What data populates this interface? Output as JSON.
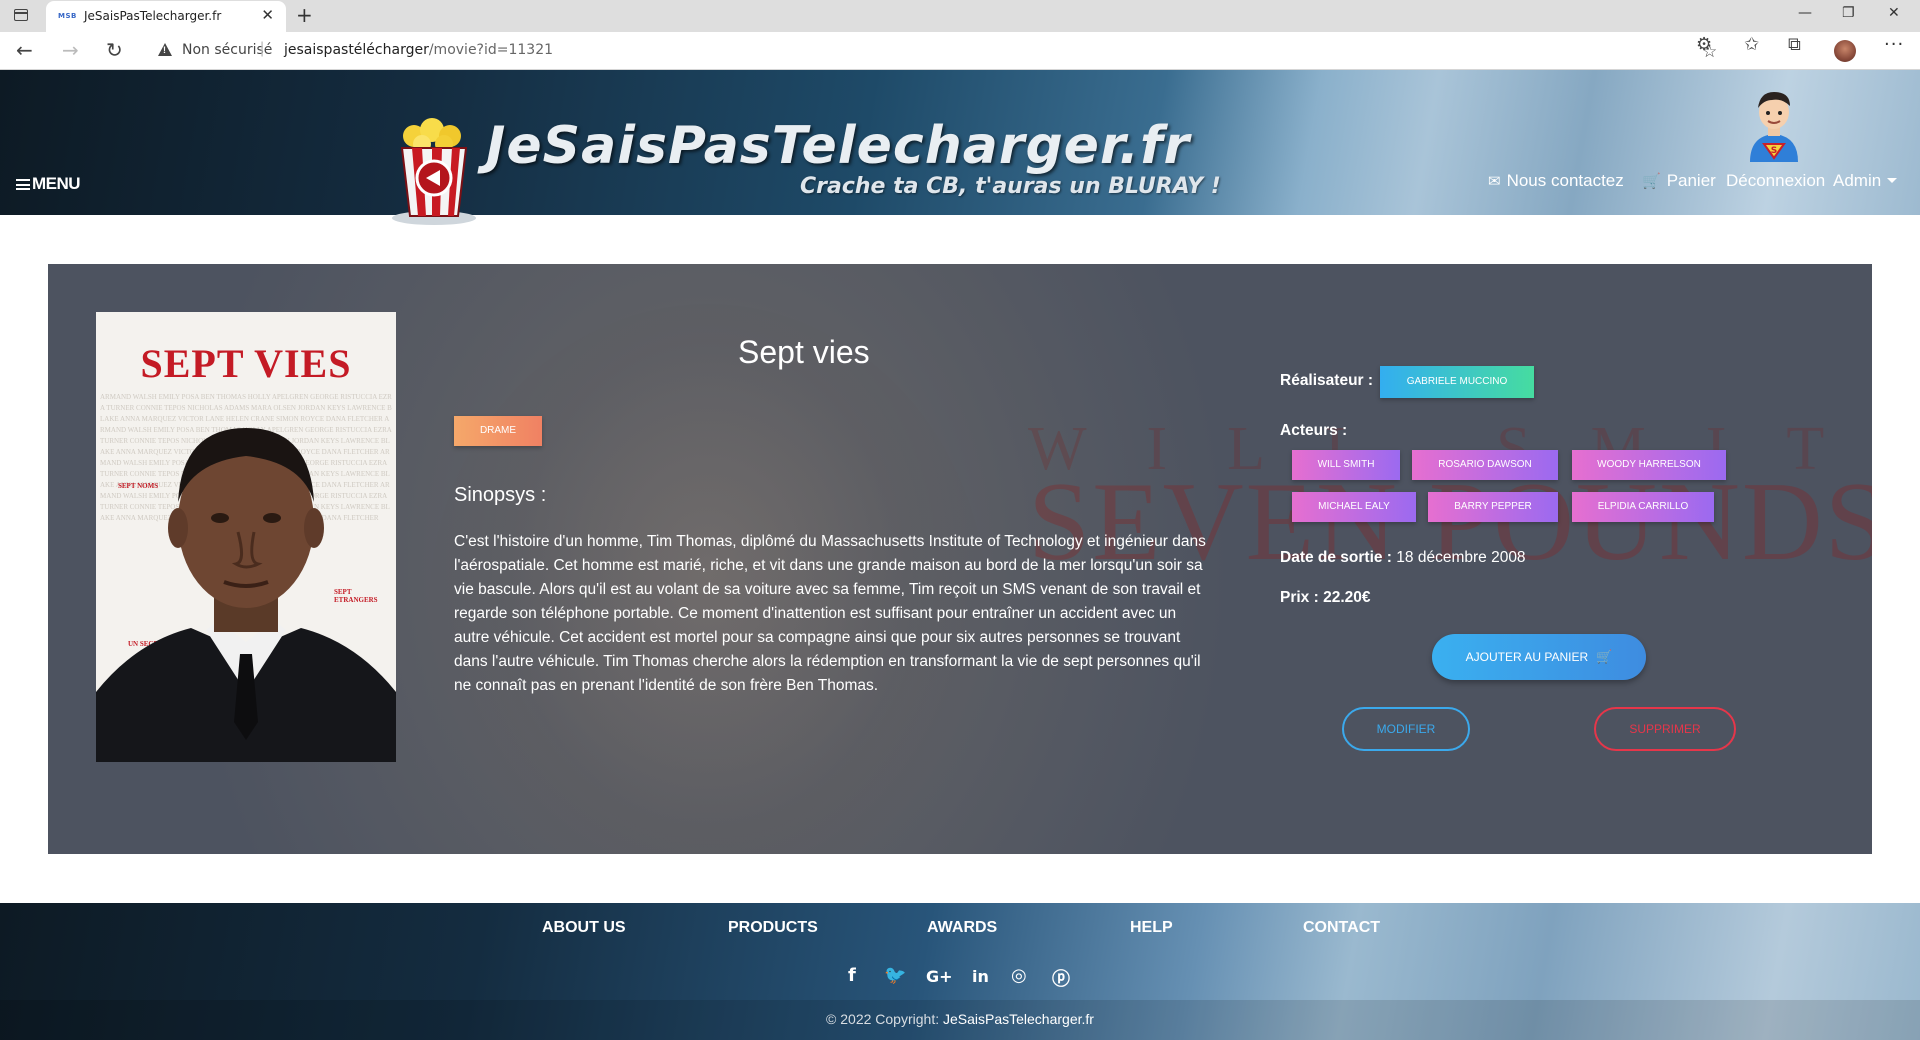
{
  "browser": {
    "tab_title": "JeSaisPasTelecharger.fr",
    "favicon_text": "MSB",
    "security": "Non sécurisé",
    "url_host": "jesaispastélécharger",
    "url_path": "/movie?id=11321"
  },
  "header": {
    "menu_label": "MENU",
    "site_title": "JeSaisPasTelecharger.fr",
    "tagline": "Crache ta CB, t'auras un BLURAY !",
    "nav": {
      "contact": "Nous contactez",
      "cart": "Panier",
      "logout": "Déconnexion",
      "user": "Admin"
    }
  },
  "movie": {
    "title": "Sept vies",
    "poster_title": "SEPT VIES",
    "genre": "DRAME",
    "synopsis_heading": "Sinopsys :",
    "synopsis": "C'est l'histoire d'un homme, Tim Thomas, diplômé du Massachusetts Institute of Technology et ingénieur dans l'aérospatiale. Cet homme est marié, riche, et vit dans une grande maison au bord de la mer lorsqu'un soir sa vie bascule. Alors qu'il est au volant de sa voiture avec sa femme, Tim reçoit un SMS venant de son travail et regarde son téléphone portable. Ce moment d'inattention est suffisant pour entraîner un accident avec un autre véhicule. Cet accident est mortel pour sa compagne ainsi que pour six autres personnes se trouvant dans l'autre véhicule. Tim Thomas cherche alors la rédemption en transformant la vie de sept personnes qu'il ne connaît pas en prenant l'identité de son frère Ben Thomas.",
    "director_label": "Réalisateur :",
    "director": "GABRIELE MUCCINO",
    "actors_label": "Acteurs :",
    "actors": [
      "WILL SMITH",
      "ROSARIO DAWSON",
      "WOODY HARRELSON",
      "MICHAEL EALY",
      "BARRY PEPPER",
      "ELPIDIA CARRILLO"
    ],
    "release_label": "Date de sortie :",
    "release_date": "18 décembre 2008",
    "price_label": "Prix :",
    "price": "22.20€",
    "add_to_cart": "AJOUTER AU PANIER",
    "edit": "MODIFIER",
    "delete": "SUPPRIMER"
  },
  "footer": {
    "links": [
      "ABOUT US",
      "PRODUCTS",
      "AWARDS",
      "HELP",
      "CONTACT"
    ],
    "social_icons": [
      "facebook-icon",
      "twitter-icon",
      "google-plus-icon",
      "linkedin-icon",
      "instagram-icon",
      "pinterest-icon"
    ],
    "copyright_prefix": "© 2022 Copyright:",
    "copyright_site": "JeSaisPasTelecharger.fr"
  },
  "colors": {
    "genre_badge": "#f08163",
    "director_badge": "#33aef0",
    "actor_badge": "#c46fe0",
    "edit_button": "#3ba9ec",
    "delete_button": "#e6364a"
  }
}
